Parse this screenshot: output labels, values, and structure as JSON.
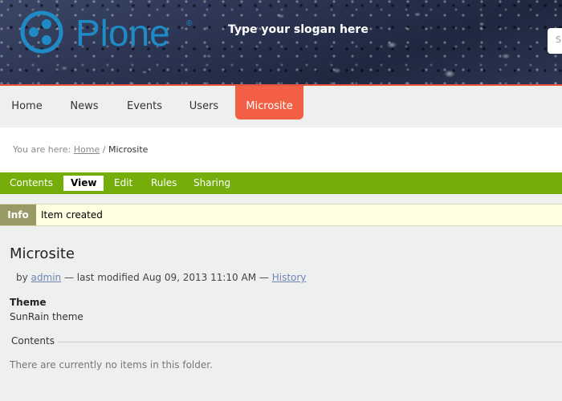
{
  "header": {
    "logo_text": "Plone",
    "slogan": "Type your slogan here",
    "search_placeholder": "S"
  },
  "nav": {
    "items": [
      {
        "label": "Home"
      },
      {
        "label": "News"
      },
      {
        "label": "Events"
      },
      {
        "label": "Users"
      },
      {
        "label": "Microsite",
        "active": true
      }
    ]
  },
  "breadcrumb": {
    "prefix": "You are here:",
    "home": "Home",
    "separator": "/",
    "current": "Microsite"
  },
  "editbar": {
    "tabs": [
      {
        "label": "Contents"
      },
      {
        "label": "View",
        "selected": true
      },
      {
        "label": "Edit"
      },
      {
        "label": "Rules"
      },
      {
        "label": "Sharing"
      }
    ]
  },
  "message": {
    "type": "Info",
    "text": "Item created"
  },
  "content": {
    "title": "Microsite",
    "by": "by",
    "author": "admin",
    "modified": "— last modified Aug 09, 2013 11:10 AM —",
    "history_link": "History",
    "theme_label": "Theme",
    "theme_value": "SunRain theme",
    "contents_legend": "Contents",
    "empty_text": "There are currently no items in this folder."
  },
  "colors": {
    "accent_nav": "#f25f44",
    "editbar": "#75ad0a",
    "logo": "#1e8ac6"
  }
}
